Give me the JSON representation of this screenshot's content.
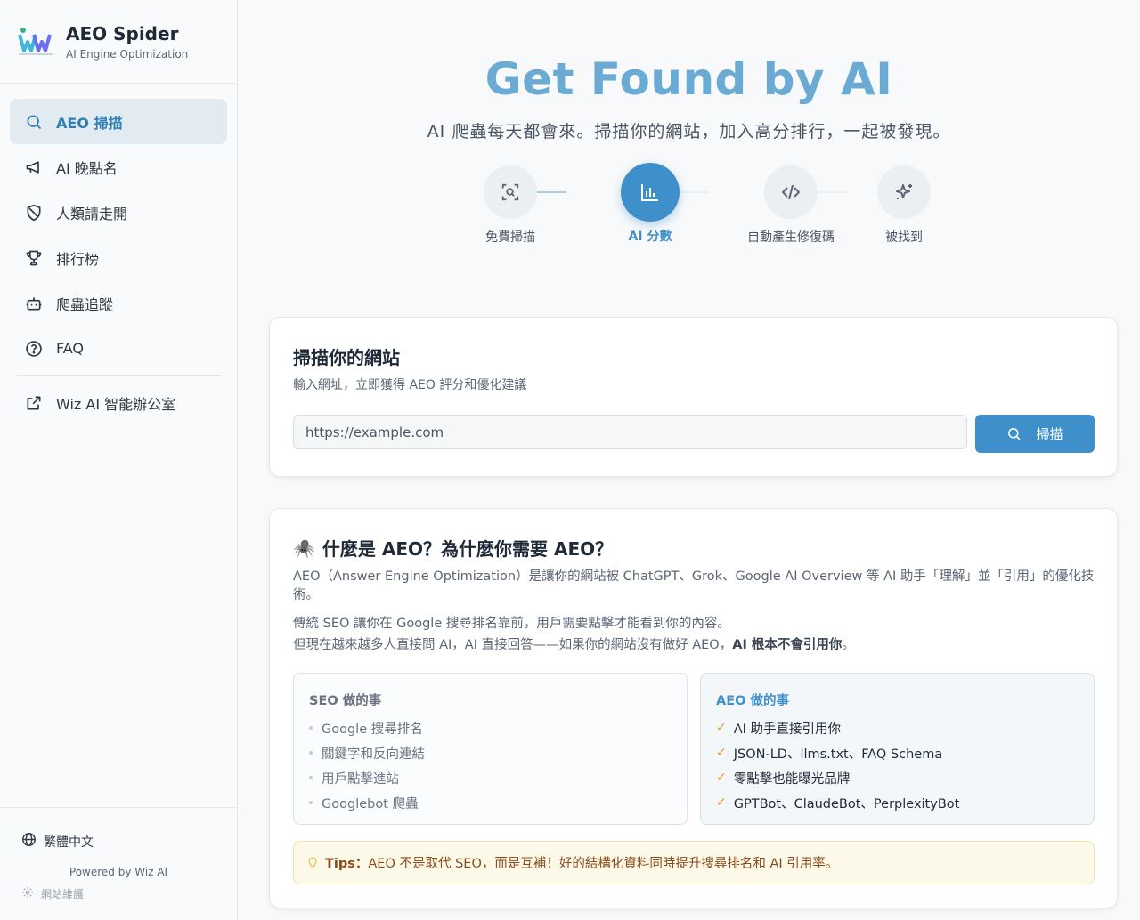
{
  "brand": {
    "title": "AEO Spider",
    "subtitle": "AI Engine Optimization"
  },
  "sidebar": {
    "items": [
      {
        "label": "AEO 掃描",
        "icon": "search-icon",
        "active": true
      },
      {
        "label": "AI 晚點名",
        "icon": "megaphone-icon"
      },
      {
        "label": "人類請走開",
        "icon": "shield-off-icon"
      },
      {
        "label": "排行榜",
        "icon": "trophy-icon"
      },
      {
        "label": "爬蟲追蹤",
        "icon": "bot-icon"
      },
      {
        "label": "FAQ",
        "icon": "help-circle-icon"
      }
    ],
    "external": {
      "label": "Wiz AI 智能辦公室",
      "icon": "external-link-icon"
    },
    "footer": {
      "language": "繁體中文",
      "powered": "Powered by Wiz AI",
      "maintenance": "網站維護"
    }
  },
  "hero": {
    "title": "Get Found by AI",
    "subtitle": "AI 爬蟲每天都會來。掃描你的網站，加入高分排行，一起被發現。",
    "steps": [
      {
        "label": "免費掃描",
        "icon": "scan-search-icon"
      },
      {
        "label": "AI 分數",
        "icon": "bar-chart-icon",
        "active": true
      },
      {
        "label": "自動產生修復碼",
        "icon": "code-icon"
      },
      {
        "label": "被找到",
        "icon": "sparkles-icon"
      }
    ]
  },
  "scan_card": {
    "title": "掃描你的網站",
    "description": "輸入網址，立即獲得 AEO 評分和優化建議",
    "placeholder": "https://example.com",
    "button": "掃描"
  },
  "about_card": {
    "emoji": "🕷️",
    "title": "什麼是 AEO？為什麼你需要 AEO？",
    "p1": "AEO（Answer Engine Optimization）是讓你的網站被 ChatGPT、Grok、Google AI Overview 等 AI 助手「理解」並「引用」的優化技術。",
    "p2": "傳統 SEO 讓你在 Google 搜尋排名靠前，用戶需要點擊才能看到你的內容。",
    "p3_prefix": "但現在越來越多人直接問 AI，AI 直接回答——如果你的網站沒有做好 AEO，",
    "p3_bold": "AI 根本不會引用你",
    "p3_suffix": "。",
    "seo": {
      "title": "SEO 做的事",
      "items": [
        "Google 搜尋排名",
        "關鍵字和反向連結",
        "用戶點擊進站",
        "Googlebot 爬蟲"
      ]
    },
    "aeo": {
      "title": "AEO 做的事",
      "items": [
        "AI 助手直接引用你",
        "JSON-LD、llms.txt、FAQ Schema",
        "零點擊也能曝光品牌",
        "GPTBot、ClaudeBot、PerplexityBot"
      ]
    },
    "tips_label": "Tips：",
    "tips_text": "AEO 不是取代 SEO，而是互補！好的結構化資料同時提升搜尋排名和 AI 引用率。"
  }
}
